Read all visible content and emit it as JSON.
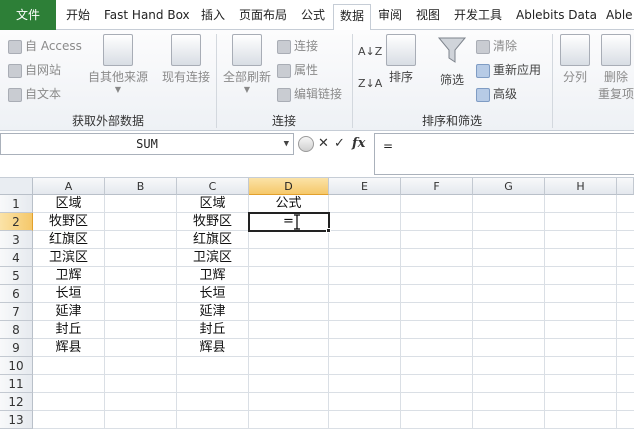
{
  "tabs": [
    {
      "label": "文件"
    },
    {
      "label": "开始"
    },
    {
      "label": "Fast Hand Box"
    },
    {
      "label": "插入"
    },
    {
      "label": "页面布局"
    },
    {
      "label": "公式"
    },
    {
      "label": "数据"
    },
    {
      "label": "审阅"
    },
    {
      "label": "视图"
    },
    {
      "label": "开发工具"
    },
    {
      "label": "Ablebits Data"
    },
    {
      "label": "Able"
    }
  ],
  "ribbon": {
    "external": {
      "from_access": "自 Access",
      "from_web": "自网站",
      "from_text": "自文本",
      "from_other": "自其他来源",
      "existing": "现有连接",
      "group_label": "获取外部数据"
    },
    "connections": {
      "refresh_all": "全部刷新",
      "connections": "连接",
      "properties": "属性",
      "edit_links": "编辑链接",
      "group_label": "连接"
    },
    "sort_filter": {
      "sort": "排序",
      "filter": "筛选",
      "clear": "清除",
      "reapply": "重新应用",
      "advanced": "高级",
      "group_label": "排序和筛选"
    },
    "tools": {
      "split": "分列",
      "remove": "删除",
      "remove2": "重复项"
    }
  },
  "formula_bar": {
    "name_box": "SUM",
    "formula": "="
  },
  "grid": {
    "columns": [
      "A",
      "B",
      "C",
      "D",
      "E",
      "F",
      "G",
      "H"
    ],
    "rows": [
      "1",
      "2",
      "3",
      "4",
      "5",
      "6",
      "7",
      "8",
      "9",
      "10",
      "11",
      "12",
      "13"
    ],
    "col_a": [
      "区域",
      "牧野区",
      "红旗区",
      "卫滨区",
      "卫辉",
      "长垣",
      "延津",
      "封丘",
      "辉县"
    ],
    "col_c": [
      "区域",
      "牧野区",
      "红旗区",
      "卫滨区",
      "卫辉",
      "长垣",
      "延津",
      "封丘",
      "辉县"
    ],
    "d1": "公式",
    "d2": "="
  },
  "colors": {
    "file_tab": "#2d7f37",
    "selected_header": "#f5c86a"
  }
}
